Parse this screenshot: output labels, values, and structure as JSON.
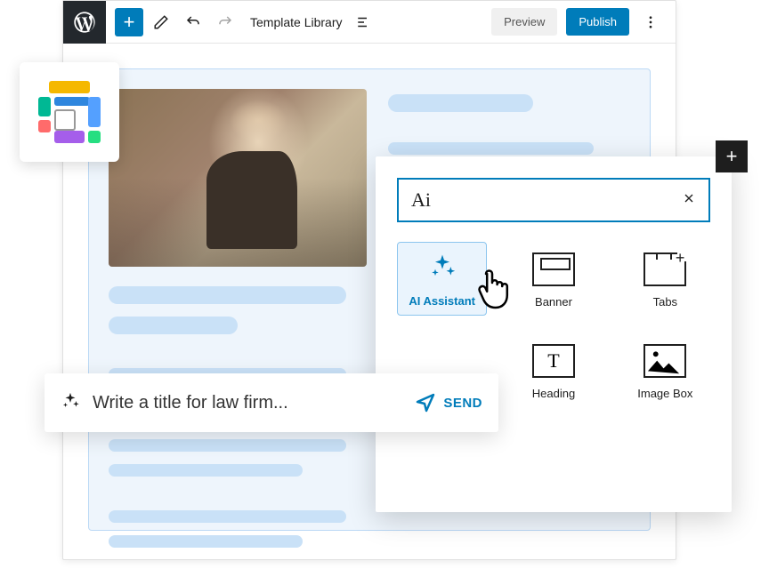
{
  "toolbar": {
    "template_label": "Template Library",
    "preview_label": "Preview",
    "publish_label": "Publish"
  },
  "block_panel": {
    "search_value": "Ai",
    "items": [
      {
        "label": "AI Assistant"
      },
      {
        "label": "Banner"
      },
      {
        "label": "Tabs"
      },
      {
        "label": "Heading"
      },
      {
        "label": "Image Box"
      }
    ]
  },
  "prompt": {
    "text": "Write a title for law firm...",
    "send_label": "SEND"
  }
}
